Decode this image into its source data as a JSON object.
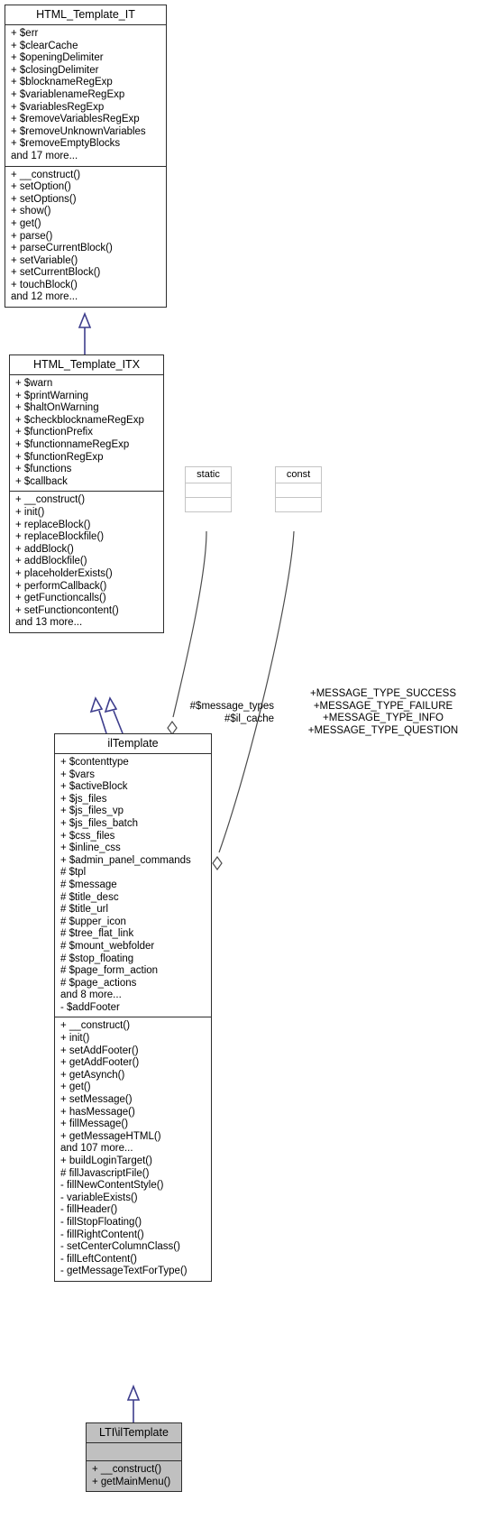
{
  "diagram": {
    "type": "uml-class-diagram",
    "background": "#ffffff",
    "inheritance_line_color": "#3d3d8c",
    "aggregation_line_color": "#4c4c4c",
    "box_border_color": "#2d2d2d",
    "note_border_color": "#c4c4c4",
    "highlight_fill": "#c0c0c0"
  },
  "classes": {
    "html_template_it": {
      "name": "HTML_Template_IT",
      "attributes": [
        "+ $err",
        "+ $clearCache",
        "+ $openingDelimiter",
        "+ $closingDelimiter",
        "+ $blocknameRegExp",
        "+ $variablenameRegExp",
        "+ $variablesRegExp",
        "+ $removeVariablesRegExp",
        "+ $removeUnknownVariables",
        "+ $removeEmptyBlocks",
        "and 17 more..."
      ],
      "operations": [
        "+ __construct()",
        "+ setOption()",
        "+ setOptions()",
        "+ show()",
        "+ get()",
        "+ parse()",
        "+ parseCurrentBlock()",
        "+ setVariable()",
        "+ setCurrentBlock()",
        "+ touchBlock()",
        "and 12 more..."
      ]
    },
    "html_template_itx": {
      "name": "HTML_Template_ITX",
      "attributes": [
        "+ $warn",
        "+ $printWarning",
        "+ $haltOnWarning",
        "+ $checkblocknameRegExp",
        "+ $functionPrefix",
        "+ $functionnameRegExp",
        "+ $functionRegExp",
        "+ $functions",
        "+ $callback"
      ],
      "operations": [
        "+ __construct()",
        "+ init()",
        "+ replaceBlock()",
        "+ replaceBlockfile()",
        "+ addBlock()",
        "+ addBlockfile()",
        "+ placeholderExists()",
        "+ performCallback()",
        "+ getFunctioncalls()",
        "+ setFunctioncontent()",
        "and 13 more..."
      ]
    },
    "static_note": {
      "name": "static",
      "attributes": [],
      "operations": []
    },
    "const_note": {
      "name": "const",
      "attributes": [],
      "operations": []
    },
    "il_template": {
      "name": "ilTemplate",
      "attributes": [
        "+ $contenttype",
        "+ $vars",
        "+ $activeBlock",
        "+ $js_files",
        "+ $js_files_vp",
        "+ $js_files_batch",
        "+ $css_files",
        "+ $inline_css",
        "+ $admin_panel_commands",
        "# $tpl",
        "# $message",
        "# $title_desc",
        "# $title_url",
        "# $upper_icon",
        "# $tree_flat_link",
        "# $mount_webfolder",
        "# $stop_floating",
        "# $page_form_action",
        "# $page_actions",
        "and 8 more...",
        "- $addFooter"
      ],
      "operations": [
        "+ __construct()",
        "+ init()",
        "+ setAddFooter()",
        "+ getAddFooter()",
        "+ getAsynch()",
        "+ get()",
        "+ setMessage()",
        "+ hasMessage()",
        "+ fillMessage()",
        "+ getMessageHTML()",
        "and 107 more...",
        "+ buildLoginTarget()",
        "# fillJavascriptFile()",
        "- fillNewContentStyle()",
        "- variableExists()",
        "- fillHeader()",
        "- fillStopFloating()",
        "- fillRightContent()",
        "- setCenterColumnClass()",
        "- fillLeftContent()",
        "- getMessageTextForType()"
      ]
    },
    "lti_il_template": {
      "name": "LTI\\ilTemplate",
      "attributes": [],
      "operations": [
        "+ __construct()",
        "+ getMainMenu()"
      ]
    }
  },
  "edge_labels": {
    "message_types": {
      "line1": "#$message_types",
      "line2": "#$il_cache"
    },
    "const_members": {
      "line1": "+MESSAGE_TYPE_SUCCESS",
      "line2": "+MESSAGE_TYPE_FAILURE",
      "line3": "+MESSAGE_TYPE_INFO",
      "line4": "+MESSAGE_TYPE_QUESTION"
    }
  }
}
